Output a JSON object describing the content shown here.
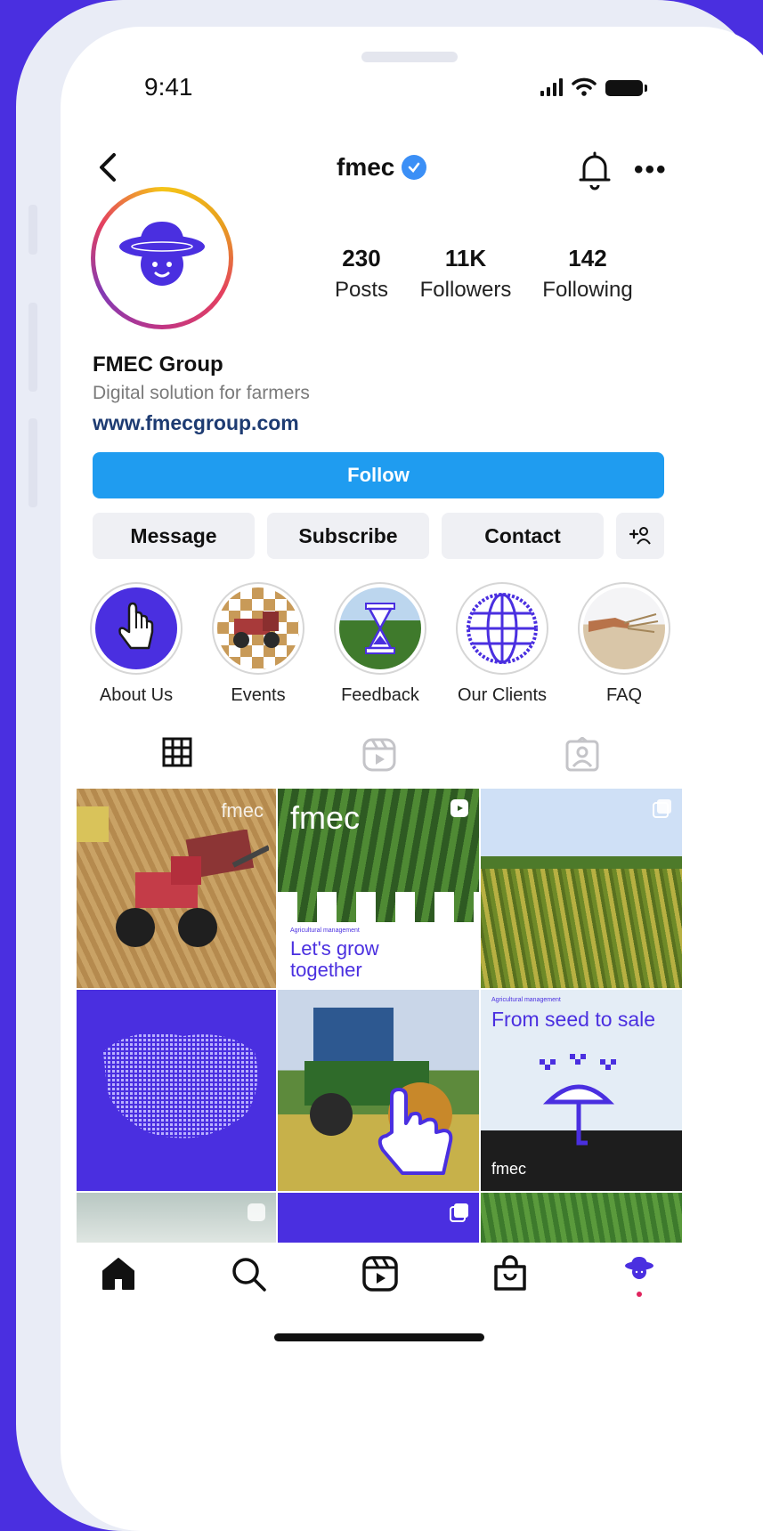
{
  "status_bar": {
    "time": "9:41"
  },
  "header": {
    "username": "fmec",
    "verified": true
  },
  "profile": {
    "stats": [
      {
        "value": "230",
        "label": "Posts"
      },
      {
        "value": "11K",
        "label": "Followers"
      },
      {
        "value": "142",
        "label": "Following"
      }
    ],
    "name": "FMEC Group",
    "bio": "Digital solution for farmers",
    "link": "www.fmecgroup.com"
  },
  "actions": {
    "follow": "Follow",
    "message": "Message",
    "subscribe": "Subscribe",
    "contact": "Contact"
  },
  "highlights": [
    {
      "label": "About Us",
      "icon": "pointer-hand-icon"
    },
    {
      "label": "Events",
      "icon": "tractor-photo"
    },
    {
      "label": "Feedback",
      "icon": "hourglass-icon"
    },
    {
      "label": "Our Clients",
      "icon": "globe-icon"
    },
    {
      "label": "FAQ",
      "icon": "hand-wheat-photo"
    }
  ],
  "tabs": [
    "grid-icon",
    "reels-icon",
    "tagged-icon"
  ],
  "posts": {
    "brand_mark": "fmec",
    "post2_kicker": "Agricultural management",
    "post2_title_line1": "Let's grow",
    "post2_title_line2": "together",
    "post6_kicker": "Agricultural management",
    "post6_title": "From seed to sale"
  },
  "colors": {
    "brand_purple": "#4a2fe0",
    "follow_blue": "#1f9cf0",
    "verified_blue": "#3b8ff6",
    "link_navy": "#1d3b72"
  },
  "bottom_nav": [
    "home-icon",
    "search-icon",
    "reels-icon",
    "shop-icon",
    "profile-avatar"
  ]
}
